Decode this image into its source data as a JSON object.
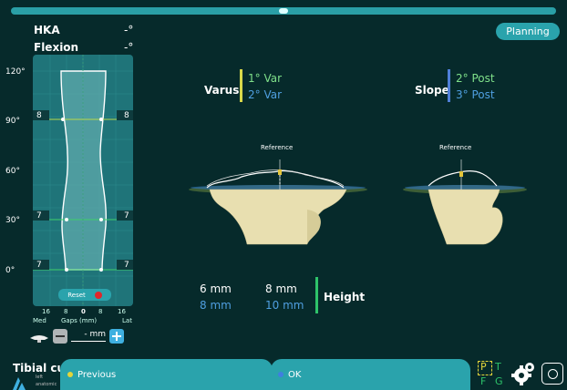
{
  "header": {
    "hka_label": "HKA",
    "hka_value": "-°",
    "flexion_label": "Flexion",
    "flexion_value": "-°"
  },
  "planning_label": "Planning",
  "gap_chart": {
    "y_ticks": [
      "120°",
      "90°",
      "60°",
      "30°",
      "0°"
    ],
    "rows": [
      {
        "left": "8",
        "right": "8"
      },
      {
        "left": "7",
        "right": "7"
      },
      {
        "left": "7",
        "right": "7"
      }
    ],
    "x_ticks": [
      "16",
      "8",
      "0",
      "8",
      "16"
    ],
    "med_label": "Med",
    "lat_label": "Lat",
    "axis_label": "Gaps (mm)",
    "reset_label": "Reset"
  },
  "stepper": {
    "value": "- mm"
  },
  "varus": {
    "label": "Varus",
    "value1": "1° Var",
    "value2": "2° Var"
  },
  "slope": {
    "label": "Slope",
    "value1": "2° Post",
    "value2": "3° Post"
  },
  "reference_label": "Reference",
  "height": {
    "left_top": "6 mm",
    "left_bottom": "8 mm",
    "right_top": "8 mm",
    "right_bottom": "10 mm",
    "label": "Height"
  },
  "footer": {
    "title": "Tibial cut",
    "side": "left",
    "mode": "anatomic",
    "previous": "Previous",
    "ok": "OK",
    "pt_p": "P",
    "pt_t": "T",
    "fg_f": "F",
    "fg_g": "G"
  },
  "colors": {
    "accent": "#2aa3ac",
    "yellow": "#d8d84a",
    "blue": "#4f9fe0",
    "green": "#2ec36a",
    "varus_green": "#7fe08a",
    "slope_blue": "#4f7fd8",
    "red": "#e0262b"
  }
}
